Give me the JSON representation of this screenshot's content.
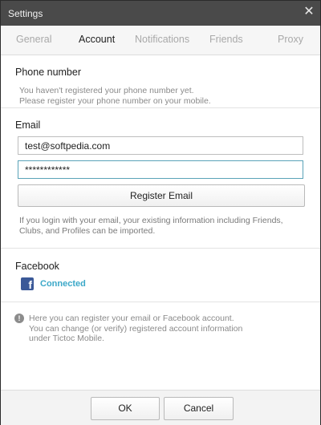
{
  "window": {
    "title": "Settings",
    "close_icon": "close-icon"
  },
  "tabs": [
    {
      "label": "General",
      "active": false
    },
    {
      "label": "Account",
      "active": true
    },
    {
      "label": "Notifications",
      "active": false
    },
    {
      "label": "Friends",
      "active": false
    },
    {
      "label": "Proxy",
      "active": false
    }
  ],
  "phone": {
    "label": "Phone number",
    "desc_line1": "You haven't registered your phone number yet.",
    "desc_line2": "Please register your phone number on your mobile."
  },
  "email": {
    "label": "Email",
    "email_value": "test@softpedia.com",
    "password_value": "************",
    "register_label": "Register Email",
    "desc_line1": "If you login with your email, your existing information including Friends,",
    "desc_line2": "Clubs, and Profiles can be imported."
  },
  "facebook": {
    "label": "Facebook",
    "icon_text": "f",
    "status": "Connected"
  },
  "info": {
    "icon": "!",
    "line1": "Here you can register your email or Facebook account.",
    "line2": "You can change (or verify) registered account information",
    "line3": "under Tictoc Mobile."
  },
  "footer": {
    "ok_label": "OK",
    "cancel_label": "Cancel"
  },
  "colors": {
    "titlebar": "#4a4a4a",
    "accent": "#3ba8c8",
    "facebook_blue": "#3b5998"
  }
}
